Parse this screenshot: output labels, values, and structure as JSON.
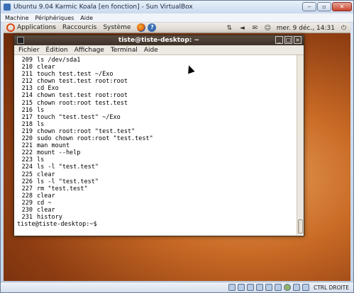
{
  "vbox": {
    "title": "Ubuntu 9.04 Karmic Koala [en fonction] - Sun VirtualBox",
    "menus": [
      "Machine",
      "Périphériques",
      "Aide"
    ],
    "controls": [
      "‒",
      "▫",
      "✕"
    ]
  },
  "gnome_panel": {
    "menus": [
      "Applications",
      "Raccourcis",
      "Système"
    ],
    "help_glyph": "?",
    "clock": "mer.  9 déc., 14:31",
    "tray_icons": [
      "network-icon",
      "volume-icon",
      "mail-icon",
      "chat-icon",
      "power-icon"
    ]
  },
  "terminal": {
    "title": "tiste@tiste-desktop: ~",
    "controls": [
      "_",
      "□",
      "×"
    ],
    "menus": [
      "Fichier",
      "Édition",
      "Affichage",
      "Terminal",
      "Aide"
    ],
    "history": [
      {
        "n": "209",
        "cmd": "ls /dev/sda1"
      },
      {
        "n": "210",
        "cmd": "clear"
      },
      {
        "n": "211",
        "cmd": "touch test.test ~/Exo"
      },
      {
        "n": "212",
        "cmd": "chown test.test root:root"
      },
      {
        "n": "213",
        "cmd": "cd Exo"
      },
      {
        "n": "214",
        "cmd": "chown test.test root:root"
      },
      {
        "n": "215",
        "cmd": "chown root:root test.test"
      },
      {
        "n": "216",
        "cmd": "ls"
      },
      {
        "n": "217",
        "cmd": "touch \"test.test\" ~/Exo"
      },
      {
        "n": "218",
        "cmd": "ls"
      },
      {
        "n": "219",
        "cmd": "chown root:root \"test.test\""
      },
      {
        "n": "220",
        "cmd": "sudo chown root:root \"test.test\""
      },
      {
        "n": "221",
        "cmd": "man mount"
      },
      {
        "n": "222",
        "cmd": "mount --help"
      },
      {
        "n": "223",
        "cmd": "ls"
      },
      {
        "n": "224",
        "cmd": "ls -l \"test.test\""
      },
      {
        "n": "225",
        "cmd": "clear"
      },
      {
        "n": "226",
        "cmd": "ls -l \"test.test\""
      },
      {
        "n": "227",
        "cmd": "rm \"test.test\""
      },
      {
        "n": "228",
        "cmd": "clear"
      },
      {
        "n": "229",
        "cmd": "cd ~"
      },
      {
        "n": "230",
        "cmd": "clear"
      },
      {
        "n": "231",
        "cmd": "history"
      }
    ],
    "prompt": "tiste@tiste-desktop:~$"
  },
  "statusbar": {
    "host_key": "CTRL DROITE"
  }
}
